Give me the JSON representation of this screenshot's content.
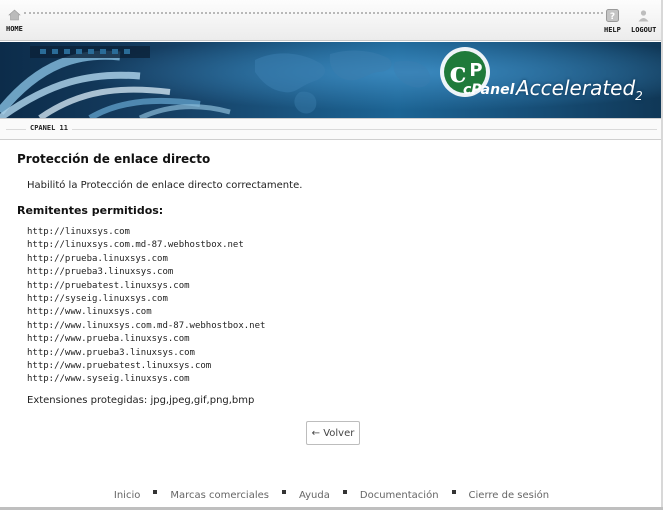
{
  "topbar": {
    "home_label": "HOME",
    "help_label": "HELP",
    "logout_label": "LOGOUT"
  },
  "banner": {
    "brand": "cPanel",
    "product": "Accelerated",
    "version_mark": "2"
  },
  "subbar": {
    "version": "CPANEL 11"
  },
  "main": {
    "title": "Protección de enlace directo",
    "message": "Habilitó la Protección de enlace directo correctamente.",
    "referrers_heading": "Remitentes permitidos:",
    "urls": [
      "http://linuxsys.com",
      "http://linuxsys.com.md-87.webhostbox.net",
      "http://prueba.linuxsys.com",
      "http://prueba3.linuxsys.com",
      "http://pruebatest.linuxsys.com",
      "http://syseig.linuxsys.com",
      "http://www.linuxsys.com",
      "http://www.linuxsys.com.md-87.webhostbox.net",
      "http://www.prueba.linuxsys.com",
      "http://www.prueba3.linuxsys.com",
      "http://www.pruebatest.linuxsys.com",
      "http://www.syseig.linuxsys.com"
    ],
    "extensions_label": "Extensiones protegidas:",
    "extensions_value": "jpg,jpeg,gif,png,bmp",
    "back_button": "← Volver"
  },
  "footer": {
    "links": [
      "Inicio",
      "Marcas comerciales",
      "Ayuda",
      "Documentación",
      "Cierre de sesión"
    ]
  },
  "colors": {
    "banner_dark": "#0c2c4a",
    "banner_mid": "#1c6494",
    "logo_green": "#1f7a3a"
  },
  "icons": {
    "home": "home-icon",
    "help": "help-icon",
    "logout": "logout-icon"
  }
}
